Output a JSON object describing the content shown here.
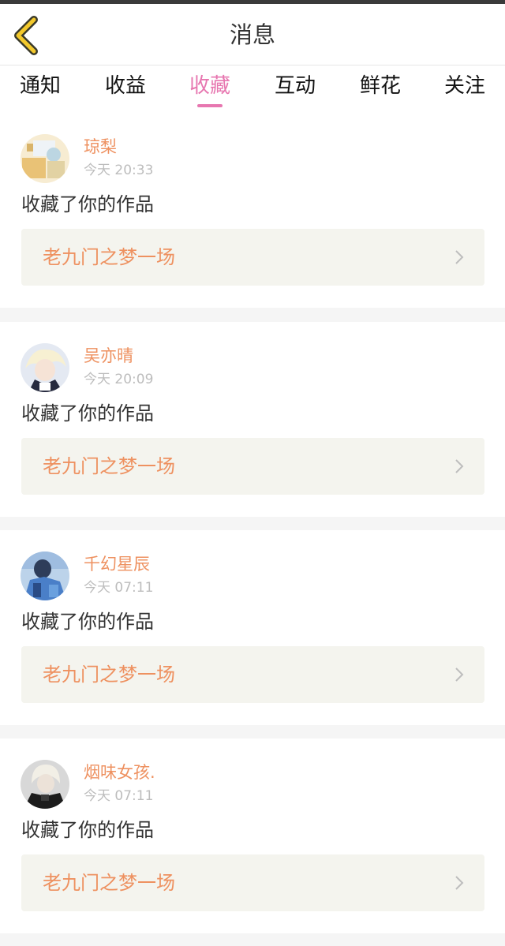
{
  "header": {
    "title": "消息",
    "back_icon": "back-chevron-icon"
  },
  "tabs": [
    {
      "label": "通知",
      "active": false
    },
    {
      "label": "收益",
      "active": false
    },
    {
      "label": "收藏",
      "active": true
    },
    {
      "label": "互动",
      "active": false
    },
    {
      "label": "鲜花",
      "active": false
    },
    {
      "label": "关注",
      "active": false
    }
  ],
  "colors": {
    "accent": "#e777b0",
    "username": "#ee9160",
    "work_box_bg": "#f4f4ee",
    "back_icon_yellow": "#f3c92c"
  },
  "messages": [
    {
      "username": "琼梨",
      "time": "今天 20:33",
      "action": "收藏了你的作品",
      "work_title": "老九门之梦一场"
    },
    {
      "username": "吴亦晴",
      "time": "今天 20:09",
      "action": "收藏了你的作品",
      "work_title": "老九门之梦一场"
    },
    {
      "username": "千幻星辰",
      "time": "今天 07:11",
      "action": "收藏了你的作品",
      "work_title": "老九门之梦一场"
    },
    {
      "username": "烟味女孩.",
      "time": "今天 07:11",
      "action": "收藏了你的作品",
      "work_title": "老九门之梦一场"
    }
  ]
}
